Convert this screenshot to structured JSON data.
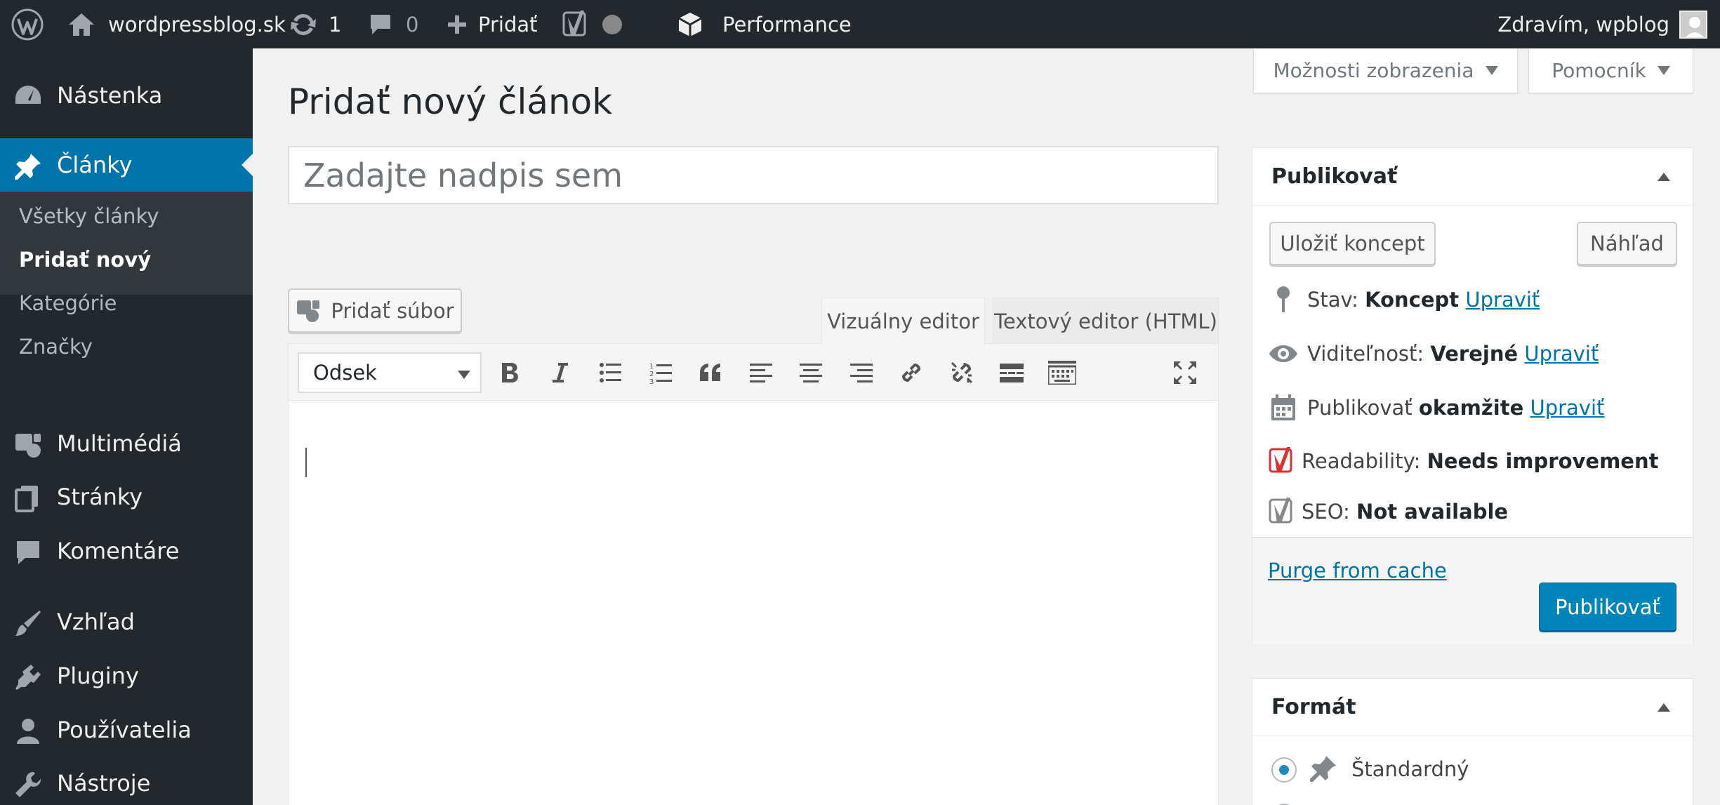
{
  "adminbar": {
    "site_name": "wordpressblog.sk",
    "updates_count": "1",
    "comments_count": "0",
    "new_label": "Pridať",
    "performance_label": "Performance",
    "greeting": "Zdravím, wpblog"
  },
  "menu": {
    "items": [
      {
        "label": "Nástenka",
        "icon": "dashboard-icon"
      },
      {
        "label": "Články",
        "icon": "pin-icon"
      },
      {
        "label": "Multimédiá",
        "icon": "media-icon"
      },
      {
        "label": "Stránky",
        "icon": "pages-icon"
      },
      {
        "label": "Komentáre",
        "icon": "comments-icon"
      },
      {
        "label": "Vzhľad",
        "icon": "appearance-icon"
      },
      {
        "label": "Pluginy",
        "icon": "plugins-icon"
      },
      {
        "label": "Používatelia",
        "icon": "users-icon"
      },
      {
        "label": "Nástroje",
        "icon": "tools-icon"
      }
    ],
    "submenu": [
      "Všetky články",
      "Pridať nový",
      "Kategórie",
      "Značky"
    ]
  },
  "screen_meta": {
    "options_label": "Možnosti zobrazenia",
    "help_label": "Pomocník"
  },
  "editor": {
    "page_title": "Pridať nový článok",
    "title_placeholder": "Zadajte nadpis sem",
    "add_media_label": "Pridať súbor",
    "tab_visual": "Vizuálny editor",
    "tab_text": "Textový editor (HTML)",
    "format_selected": "Odsek",
    "body": ""
  },
  "publish": {
    "heading": "Publikovať",
    "save_draft": "Uložiť koncept",
    "preview": "Náhľad",
    "status_label": "Stav:",
    "status_value": "Koncept",
    "visibility_label": "Viditeľnosť:",
    "visibility_value": "Verejné",
    "schedule_label": "Publikovať",
    "schedule_value": "okamžite",
    "edit_link": "Upraviť",
    "readability_label": "Readability:",
    "readability_value": "Needs improvement",
    "seo_label": "SEO:",
    "seo_value": "Not available",
    "purge_link": "Purge from cache",
    "publish_button": "Publikovať"
  },
  "format_box": {
    "heading": "Formát",
    "options": [
      {
        "label": "Štandardný",
        "checked": true
      }
    ]
  },
  "colors": {
    "admin_dark": "#23282d",
    "accent": "#0073aa",
    "primary_button": "#0085ba",
    "yoast_red": "#dc3232"
  }
}
